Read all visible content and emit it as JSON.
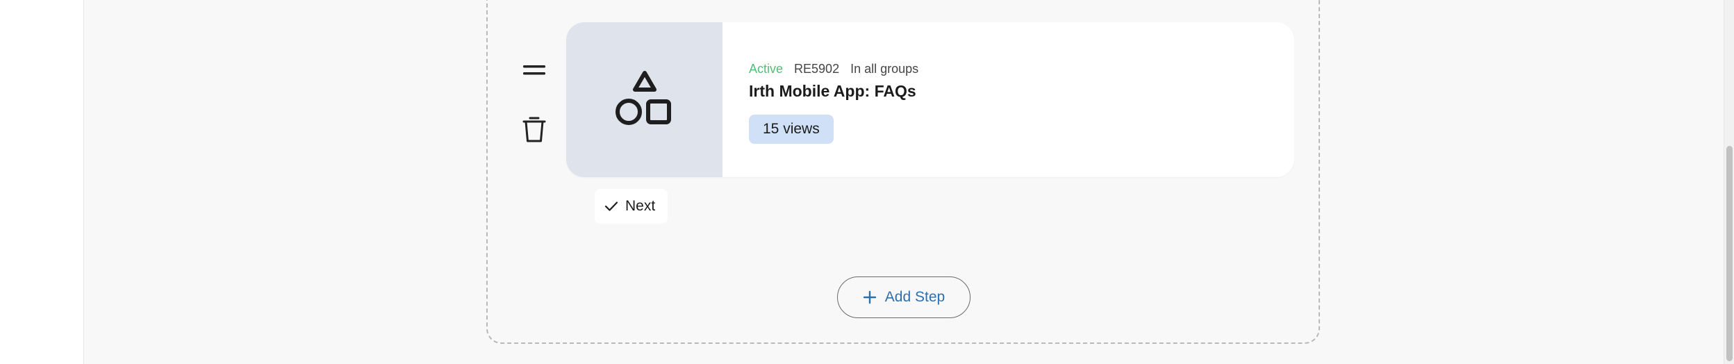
{
  "step": {
    "status": "Active",
    "id": "RE5902",
    "groups": "In all groups",
    "title": "Irth Mobile App: FAQs",
    "views": "15 views",
    "next_label": "Next"
  },
  "actions": {
    "add_step_label": "Add Step"
  },
  "icons": {
    "drag_handle": "drag-handle-icon",
    "delete": "trash-icon",
    "thumbnail": "shapes-icon",
    "next": "check-icon",
    "add": "plus-icon"
  },
  "colors": {
    "status_active": "#4fbf74",
    "accent_link": "#2c6fad",
    "badge_bg": "#cfe0f7",
    "thumb_bg": "#dfe3ec"
  }
}
